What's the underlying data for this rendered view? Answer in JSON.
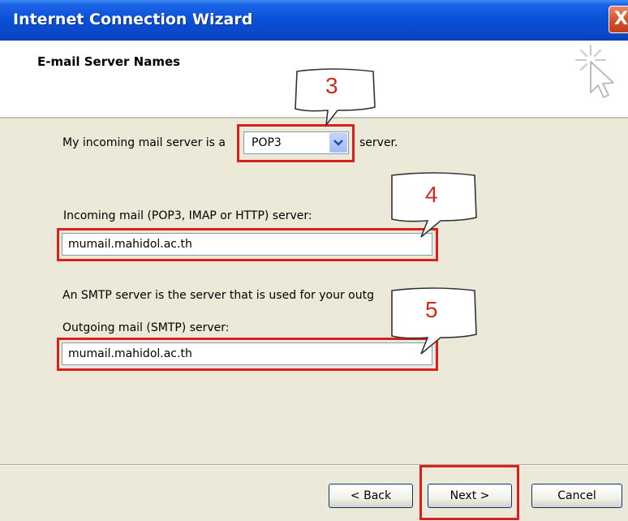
{
  "window": {
    "title": "Internet Connection Wizard",
    "close_label": "X"
  },
  "header": {
    "title": "E-mail Server Names",
    "icon": "wizard-cursor-sparkle-icon"
  },
  "incoming_type": {
    "prefix": "My incoming mail server is a",
    "value": "POP3",
    "suffix": "server."
  },
  "incoming_server": {
    "label": "Incoming mail (POP3, IMAP or HTTP) server:",
    "value": "mumail.mahidol.ac.th"
  },
  "smtp": {
    "description": "An SMTP server is the server that is used for your outg",
    "label": "Outgoing mail (SMTP) server:",
    "value": "mumail.mahidol.ac.th"
  },
  "annotations": {
    "callout_1": "3",
    "callout_2": "4",
    "callout_3": "5",
    "highlight_color": "#d8201e"
  },
  "buttons": {
    "back": "< Back",
    "next": "Next >",
    "cancel": "Cancel"
  }
}
